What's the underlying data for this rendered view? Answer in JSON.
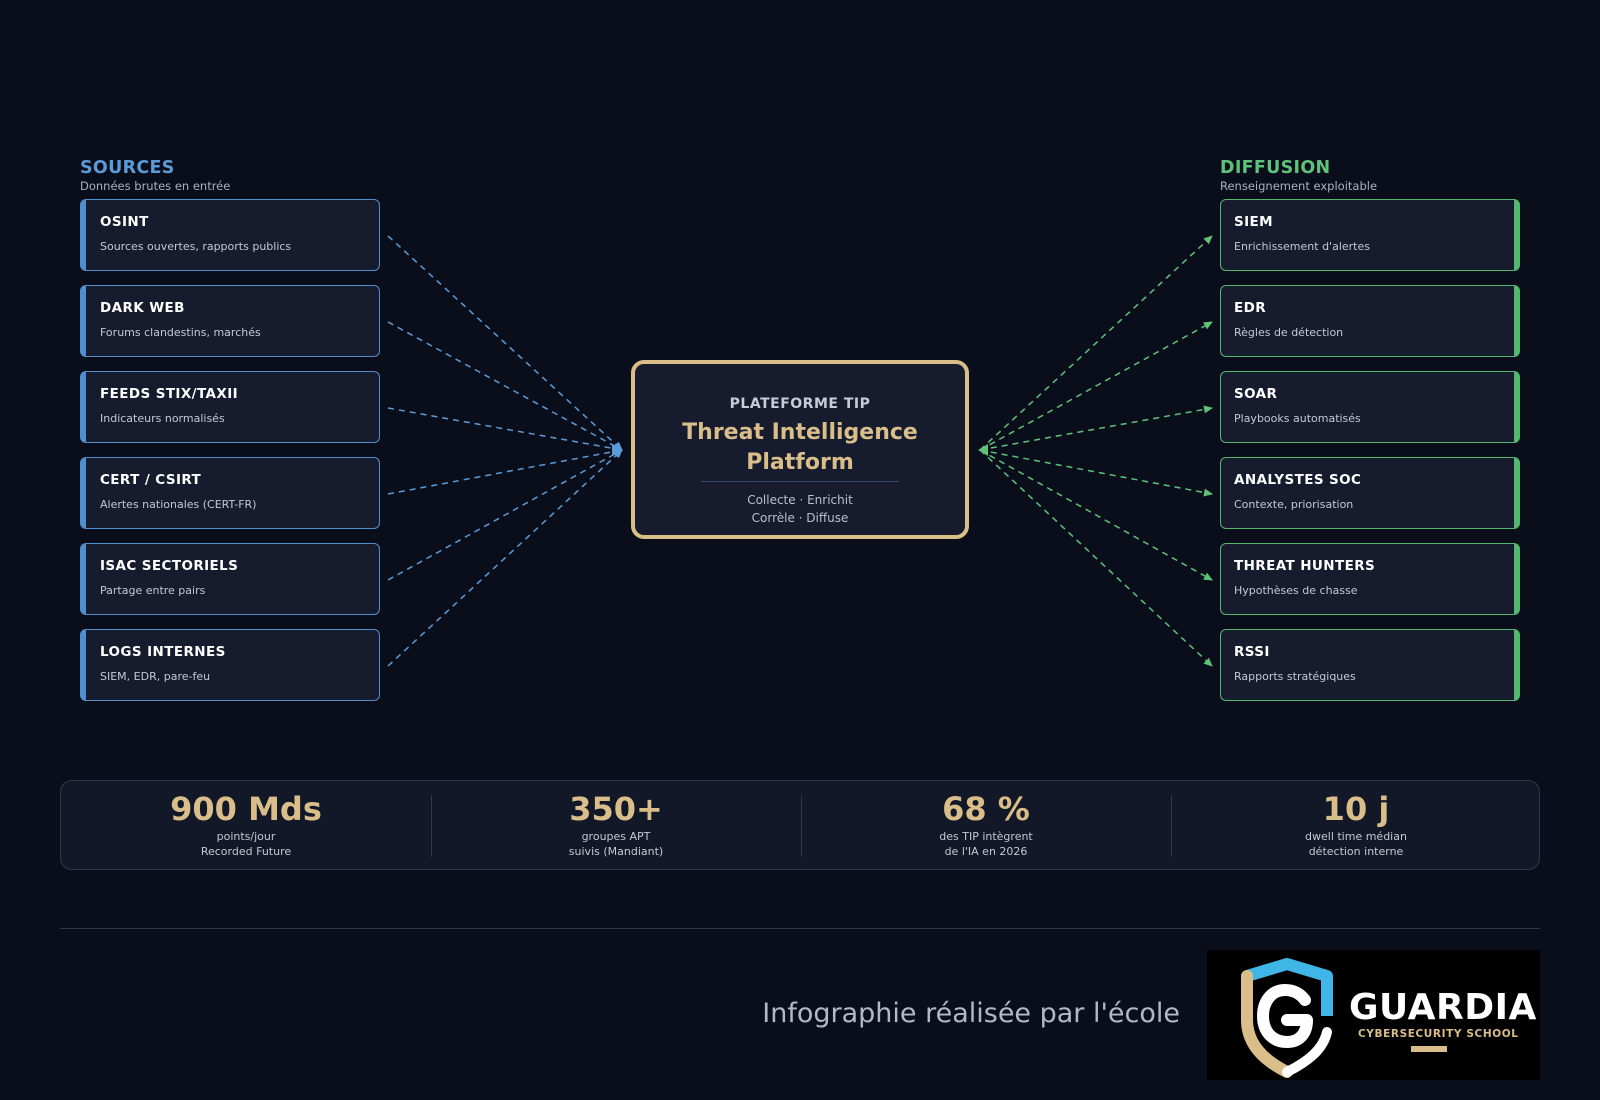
{
  "sources": {
    "title": "SOURCES",
    "subtitle": "Données brutes en entrée",
    "items": [
      {
        "title": "OSINT",
        "desc": "Sources ouvertes, rapports publics"
      },
      {
        "title": "DARK WEB",
        "desc": "Forums clandestins, marchés"
      },
      {
        "title": "FEEDS STIX/TAXII",
        "desc": "Indicateurs normalisés"
      },
      {
        "title": "CERT / CSIRT",
        "desc": "Alertes nationales (CERT-FR)"
      },
      {
        "title": "ISAC SECTORIELS",
        "desc": "Partage entre pairs"
      },
      {
        "title": "LOGS INTERNES",
        "desc": "SIEM, EDR, pare-feu"
      }
    ]
  },
  "diffusion": {
    "title": "DIFFUSION",
    "subtitle": "Renseignement exploitable",
    "items": [
      {
        "title": "SIEM",
        "desc": "Enrichissement d'alertes"
      },
      {
        "title": "EDR",
        "desc": "Règles de détection"
      },
      {
        "title": "SOAR",
        "desc": "Playbooks automatisés"
      },
      {
        "title": "ANALYSTES SOC",
        "desc": "Contexte, priorisation"
      },
      {
        "title": "THREAT HUNTERS",
        "desc": "Hypothèses de chasse"
      },
      {
        "title": "RSSI",
        "desc": "Rapports stratégiques"
      }
    ]
  },
  "platform": {
    "kicker": "PLATEFORME TIP",
    "title_line1": "Threat Intelligence",
    "title_line2": "Platform",
    "caption_line1": "Collecte · Enrichit",
    "caption_line2": "Corrèle · Diffuse"
  },
  "stats": [
    {
      "value": "900 Mds",
      "line1": "points/jour",
      "line2": "Recorded Future"
    },
    {
      "value": "350+",
      "line1": "groupes APT",
      "line2": "suivis (Mandiant)"
    },
    {
      "value": "68 %",
      "line1": "des TIP intègrent",
      "line2": "de l'IA en 2026"
    },
    {
      "value": "10 j",
      "line1": "dwell time médian",
      "line2": "détection interne"
    }
  ],
  "footer": {
    "credit": "Infographie réalisée par l'école",
    "logo_name": "GUARDIA",
    "logo_tagline": "CYBERSECURITY SCHOOL"
  },
  "colors": {
    "background": "#0a0e1a",
    "sources_accent": "#4f8fd0",
    "diffusion_accent": "#53b86e",
    "gold": "#d9be8a",
    "shield_blue": "#3fb6e6"
  }
}
